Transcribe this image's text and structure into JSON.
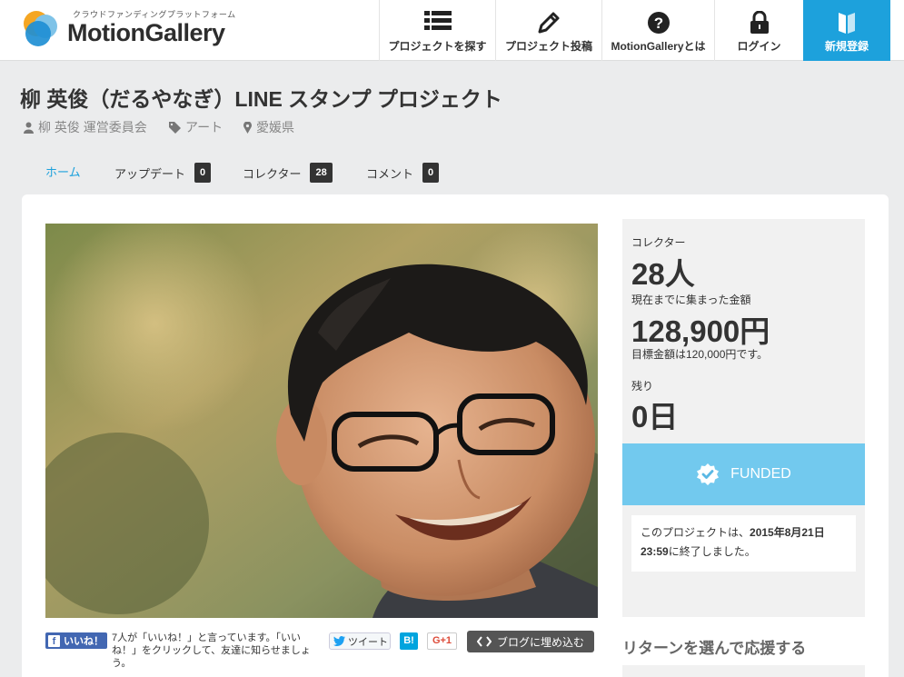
{
  "header": {
    "logo": {
      "tagline": "クラウドファンディングプラットフォーム",
      "name": "MotionGallery"
    },
    "nav": [
      {
        "label": "プロジェクトを探す",
        "icon": "list-icon"
      },
      {
        "label": "プロジェクト投稿",
        "icon": "pencil-icon"
      },
      {
        "label": "MotionGalleryとは",
        "icon": "question-icon"
      },
      {
        "label": "ログイン",
        "icon": "lock-icon"
      },
      {
        "label": "新規登録",
        "icon": "bookmark-icon"
      }
    ],
    "register_color": "#1da1dc"
  },
  "project": {
    "title": "柳 英俊（だるやなぎ）LINE スタンプ プロジェクト",
    "owner": "柳 英俊 運営委員会",
    "category": "アート",
    "location": "愛媛県"
  },
  "tabs": [
    {
      "label": "ホーム",
      "active": true
    },
    {
      "label": "アップデート",
      "count": "0"
    },
    {
      "label": "コレクター",
      "count": "28"
    },
    {
      "label": "コメント",
      "count": "0"
    }
  ],
  "social": {
    "fb_label": "いいね！",
    "fb_text": "7人が「いいね！」と言っています。「いいね！」をクリックして、友達に知らせましょう。",
    "tweet_label": "ツイート",
    "hatena_label": "B!",
    "gplus_label": "G+1",
    "embed_label": "ブログに埋め込む"
  },
  "stats": {
    "collectors_label": "コレクター",
    "collectors_value": "28人",
    "raised_label": "現在までに集まった金額",
    "raised_value": "128,900円",
    "goal_text": "目標金額は120,000円です。",
    "remaining_label": "残り",
    "remaining_value": "0日",
    "status": "FUNDED",
    "status_color": "#72c9ee",
    "ended_prefix": "このプロジェクトは、",
    "ended_date": "2015年8月21日",
    "ended_time": "23:59",
    "ended_suffix": "に終了しました。"
  },
  "returns": {
    "heading": "リターンを選んで応援する"
  }
}
